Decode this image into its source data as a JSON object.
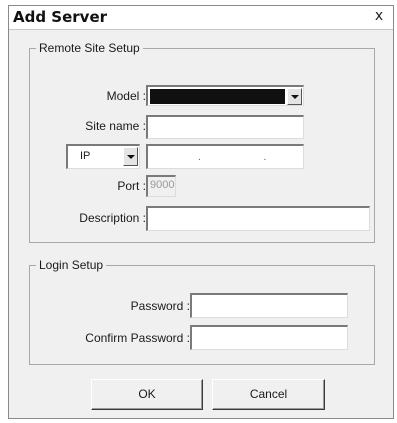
{
  "window": {
    "title": "Add Server",
    "close_glyph": "x"
  },
  "remote_site": {
    "legend": "Remote Site Setup",
    "model_label": "Model :",
    "model_value": "",
    "site_name_label": "Site name :",
    "site_name_value": "",
    "ip_type": "IP",
    "ip_value": ". . .",
    "port_label": "Port :",
    "port_value": "9000",
    "description_label": "Description :",
    "description_value": ""
  },
  "login": {
    "legend": "Login Setup",
    "password_label": "Password :",
    "password_value": "",
    "confirm_label": "Confirm Password :",
    "confirm_value": ""
  },
  "buttons": {
    "ok": "OK",
    "cancel": "Cancel"
  },
  "colors": {
    "model_selection": "#101010",
    "dialog_bg": "#f0f0f0"
  },
  "icons": {
    "close": "close-icon",
    "dropdown": "chevron-down-icon"
  }
}
